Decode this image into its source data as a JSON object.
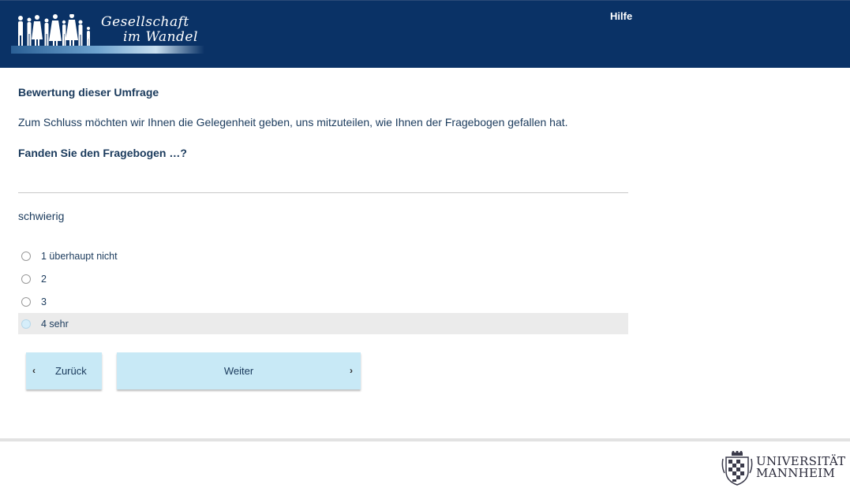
{
  "header": {
    "logo_line1": "Gesellschaft",
    "logo_line2": "im Wandel",
    "help_link": "Hilfe",
    "background_color": "#0a3266"
  },
  "main": {
    "section_title": "Bewertung dieser Umfrage",
    "intro_text": "Zum Schluss möchten wir Ihnen die Gelegenheit geben, uns mitzuteilen, wie Ihnen der Fragebogen gefallen hat.",
    "question": "Fanden Sie den Fragebogen …?",
    "item_label": "schwierig",
    "options": [
      {
        "label": "1 überhaupt nicht",
        "selected": false
      },
      {
        "label": "2",
        "selected": false
      },
      {
        "label": "3",
        "selected": false
      },
      {
        "label": "4 sehr",
        "selected": true
      }
    ]
  },
  "navigation": {
    "back_label": "Zurück",
    "next_label": "Weiter",
    "back_icon": "chevron-left-icon",
    "next_icon": "chevron-right-icon",
    "button_color": "#c8e9f6"
  },
  "footer": {
    "university_line1": "UNIVERSITÄT",
    "university_line2": "MANNHEIM"
  }
}
